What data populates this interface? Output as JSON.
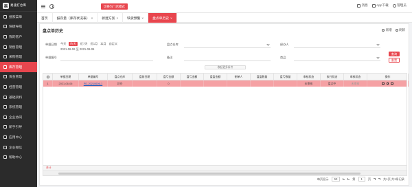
{
  "sidebar": {
    "logo_text": "易速打仓库",
    "items": [
      {
        "label": "搜索菜单"
      },
      {
        "label": "快捷导航"
      },
      {
        "label": "我的客户"
      },
      {
        "label": "销售管理"
      },
      {
        "label": "采购管理"
      },
      {
        "label": "库存管理"
      },
      {
        "label": "资金管理"
      },
      {
        "label": "经营管理"
      },
      {
        "label": "基础资料"
      },
      {
        "label": "系统管理"
      },
      {
        "label": "企业协同"
      },
      {
        "label": "新手引导"
      },
      {
        "label": "应用中心"
      },
      {
        "label": "企业微信"
      },
      {
        "label": "帮助中心"
      }
    ],
    "active_index": 5,
    "accent": "#e8464e"
  },
  "header": {
    "top_button": "切换为门店模式",
    "messages": "消息",
    "app_download": "App下载",
    "user": "管理员"
  },
  "tabs": [
    {
      "label": "首页",
      "closable": false,
      "active": false
    },
    {
      "label": "报存量（库存状况表）",
      "closable": true,
      "active": false
    },
    {
      "label": "新建方案",
      "closable": true,
      "active": false
    },
    {
      "label": "缺货预警",
      "closable": true,
      "active": false
    },
    {
      "label": "盘点单历史",
      "closable": true,
      "active": true
    }
  ],
  "page": {
    "title": "盘点单历史",
    "actions": {
      "new": "新增",
      "refresh": "刷新"
    }
  },
  "filters": {
    "date_label": "单据日期",
    "date_options": [
      "今天",
      "昨天",
      "近7天",
      "近1月",
      "本月",
      "自定义"
    ],
    "date_active_index": 1,
    "date_range": "2021-06-06 至 2021-06-06",
    "warehouse_label": "盘点仓库",
    "handler_label": "经办人",
    "bill_no_label": "单据编号",
    "remark_label": "备注",
    "product_label": "商品",
    "query_button": "查询",
    "reset_button": "重置",
    "collapse_label": "收起更多条件"
  },
  "table": {
    "columns": [
      "序",
      "单据日期",
      "单据编号",
      "盘点仓库",
      "盘前日期",
      "盘亏金额",
      "盘亏金额",
      "盘盈金额",
      "制单人",
      "盘盈数量",
      "盘亏数量",
      "审核状态",
      "执行状态",
      "审核状态",
      "操作"
    ],
    "rows": [
      {
        "index": "1",
        "date": "2021-06-06",
        "bill_no": "PD-20210606-1",
        "warehouse": "总仓",
        "pre_date": "",
        "loss_amount": "0",
        "loss_amount2": "",
        "gain_amount": "",
        "maker": "",
        "gain_qty": "",
        "loss_qty": "",
        "audit": "未审核",
        "exec": "盘点中",
        "audit2": "未审核"
      }
    ],
    "footer_label": "合计"
  },
  "pager": {
    "prefix": "每页显示",
    "page_size": "50",
    "page_label": "第",
    "current_page": "1",
    "page_suffix": "页",
    "summary": "共1页 共1条记录"
  }
}
